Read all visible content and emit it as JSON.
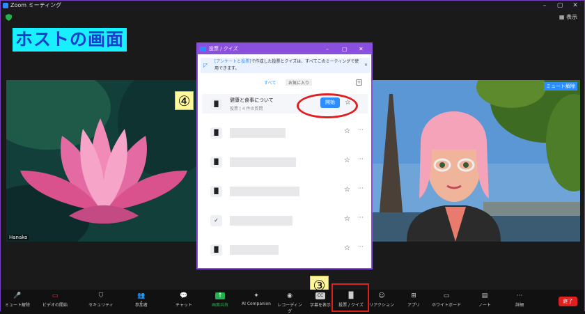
{
  "window": {
    "title": "Zoom ミーティング",
    "view_label": "表示"
  },
  "host_label": "ホストの画面",
  "participant_left": {
    "name": "Hanako"
  },
  "participant_right": {
    "mute_label": "ミュート解除"
  },
  "badges": {
    "four": "④",
    "three": "③"
  },
  "dialog": {
    "title": "投票 / クイズ",
    "info_link": "[アンケートと投票]",
    "info_text": "で作成した投票とクイズは、すべてこのミーティングで使用できます。",
    "tabs": [
      "すべて",
      "お気に入り"
    ],
    "first_item": {
      "title": "健康と食事について",
      "subtitle": "投票 | 4 件の質問",
      "start_label": "開始"
    }
  },
  "toolbar": {
    "items": [
      {
        "label": "ミュート解除",
        "icon": "mic-muted-icon"
      },
      {
        "label": "ビデオの開始",
        "icon": "camera-off-icon"
      },
      {
        "label": "セキュリティ",
        "icon": "shield-icon"
      },
      {
        "label": "参加者",
        "icon": "participants-icon",
        "count": "2"
      },
      {
        "label": "チャット",
        "icon": "chat-icon"
      },
      {
        "label": "画面共有",
        "icon": "share-screen-icon"
      },
      {
        "label": "AI Companion",
        "icon": "ai-companion-icon"
      },
      {
        "label": "レコーディング",
        "icon": "record-icon"
      },
      {
        "label": "字幕を表示",
        "icon": "captions-icon"
      },
      {
        "label": "投票 / クイズ",
        "icon": "poll-icon"
      },
      {
        "label": "リアクション",
        "icon": "reaction-icon"
      },
      {
        "label": "アプリ",
        "icon": "apps-icon"
      },
      {
        "label": "ホワイトボード",
        "icon": "whiteboard-icon"
      },
      {
        "label": "ノート",
        "icon": "notes-icon"
      },
      {
        "label": "詳細",
        "icon": "more-icon"
      }
    ],
    "end_label": "終了"
  },
  "colors": {
    "accent": "#2d8cff",
    "dialog_frame": "#8b4fe0",
    "highlight_red": "#e02020",
    "host_label_bg": "#18f0ff"
  }
}
